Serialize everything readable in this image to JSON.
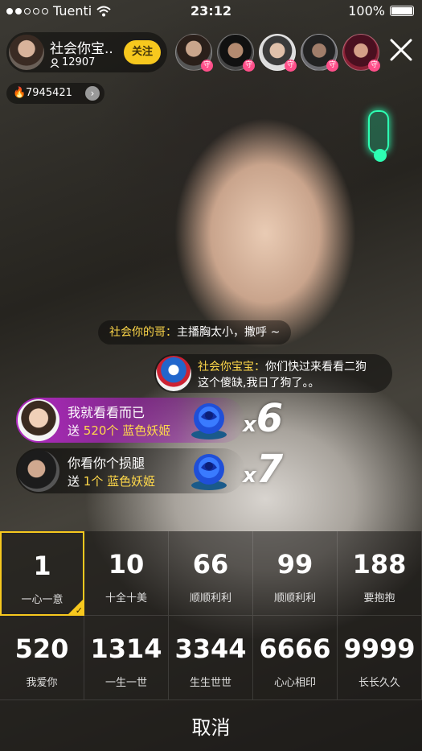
{
  "status_bar": {
    "carrier": "Tuenti",
    "time": "23:12",
    "battery": "100%"
  },
  "host": {
    "name": "社会你宝..",
    "fans": "12907",
    "follow_label": "关注"
  },
  "viewers": [
    "守",
    "守",
    "守",
    "守",
    "守"
  ],
  "hot": {
    "value": "7945421"
  },
  "chat": [
    {
      "user": "社会你的哥：",
      "text": "主播胸太小，撒呼 ~"
    },
    {
      "user": "社会你宝宝：",
      "line1": "你们快过来看看二狗",
      "line2": "这个傻缺,我日了狗了。。"
    }
  ],
  "gifts": [
    {
      "sender": "我就看看而已",
      "prefix": "送",
      "qty": "520个",
      "gift": "蓝色妖姬",
      "combo_x": "x",
      "combo": "6"
    },
    {
      "sender": "你看你个损腿",
      "prefix": "送",
      "qty": "1个",
      "gift": "蓝色妖姬",
      "combo_x": "x",
      "combo": "7"
    }
  ],
  "gift_amounts": [
    {
      "number": "1",
      "label": "一心一意",
      "selected": true
    },
    {
      "number": "10",
      "label": "十全十美"
    },
    {
      "number": "66",
      "label": "顺顺利利"
    },
    {
      "number": "99",
      "label": "顺顺利利"
    },
    {
      "number": "188",
      "label": "要抱抱"
    },
    {
      "number": "520",
      "label": "我爱你"
    },
    {
      "number": "1314",
      "label": "一生一世"
    },
    {
      "number": "3344",
      "label": "生生世世"
    },
    {
      "number": "6666",
      "label": "心心相印"
    },
    {
      "number": "9999",
      "label": "长长久久"
    }
  ],
  "cancel_label": "取消",
  "colors": {
    "accent": "#f7c81e",
    "gift_highlight": "#ffd84a",
    "gift_banner": "#be28d2"
  }
}
